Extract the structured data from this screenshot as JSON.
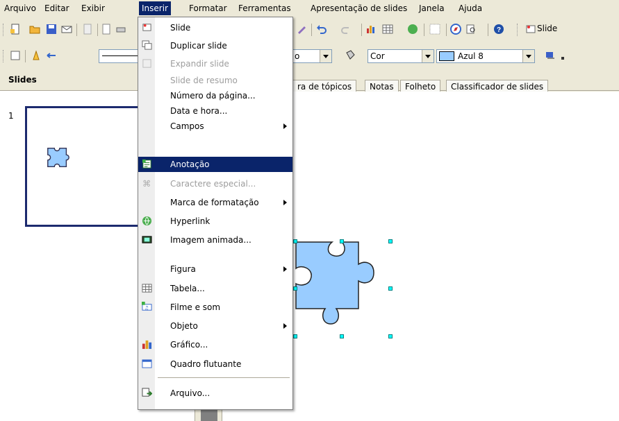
{
  "menubar": {
    "items": [
      "Arquivo",
      "Editar",
      "Exibir",
      "Inserir",
      "Formatar",
      "Ferramentas",
      "Apresentação de slides",
      "Janela",
      "Ajuda"
    ],
    "active": "Inserir"
  },
  "toolbar2": {
    "line_style_value": "",
    "area_style_partial": "o",
    "area_fill_type": "Cor",
    "area_color": "Azul 8",
    "area_color_hex": "#99ccff"
  },
  "toolbar1": {
    "right_label": "Slide"
  },
  "left_panel": {
    "title": "Slides",
    "slide_number": "1"
  },
  "view_tabs": [
    "ra de tópicos",
    "Notas",
    "Folheto",
    "Classificador de slides"
  ],
  "insert_menu": {
    "items": [
      {
        "label": "Slide",
        "icon": "new-slide-icon",
        "disabled": false
      },
      {
        "label": "Duplicar slide",
        "icon": "duplicate-slide-icon",
        "disabled": false
      },
      {
        "label": "Expandir slide",
        "icon": "expand-slide-icon",
        "disabled": true
      },
      {
        "label": "Slide de resumo",
        "icon": "",
        "disabled": true
      },
      {
        "label": "Número da página...",
        "icon": "",
        "disabled": false
      },
      {
        "label": "Data e hora...",
        "icon": "",
        "disabled": false
      },
      {
        "label": "Campos",
        "icon": "",
        "disabled": false,
        "submenu": true
      },
      {
        "label": "Anotação",
        "icon": "annotation-icon",
        "disabled": false,
        "highlighted": true
      },
      {
        "label": "Caractere especial...",
        "icon": "special-character-icon",
        "disabled": true
      },
      {
        "label": "Marca de formatação",
        "icon": "",
        "disabled": false,
        "submenu": true
      },
      {
        "label": "Hyperlink",
        "icon": "hyperlink-icon",
        "disabled": false
      },
      {
        "label": "Imagem animada...",
        "icon": "animated-image-icon",
        "disabled": false
      },
      {
        "label": "Figura",
        "icon": "",
        "disabled": false,
        "submenu": true
      },
      {
        "label": "Tabela...",
        "icon": "table-icon",
        "disabled": false
      },
      {
        "label": "Filme e som",
        "icon": "movie-sound-icon",
        "disabled": false
      },
      {
        "label": "Objeto",
        "icon": "",
        "disabled": false,
        "submenu": true
      },
      {
        "label": "Gráfico...",
        "icon": "chart-icon",
        "disabled": false
      },
      {
        "label": "Quadro flutuante",
        "icon": "floating-frame-icon",
        "disabled": false
      },
      {
        "label": "Arquivo...",
        "icon": "file-icon",
        "disabled": false
      }
    ]
  },
  "colors": {
    "menu_highlight": "#0a246a",
    "shape_fill": "#99ccff",
    "thumb_border": "#1c2a6e",
    "handle": "#00ffff"
  }
}
